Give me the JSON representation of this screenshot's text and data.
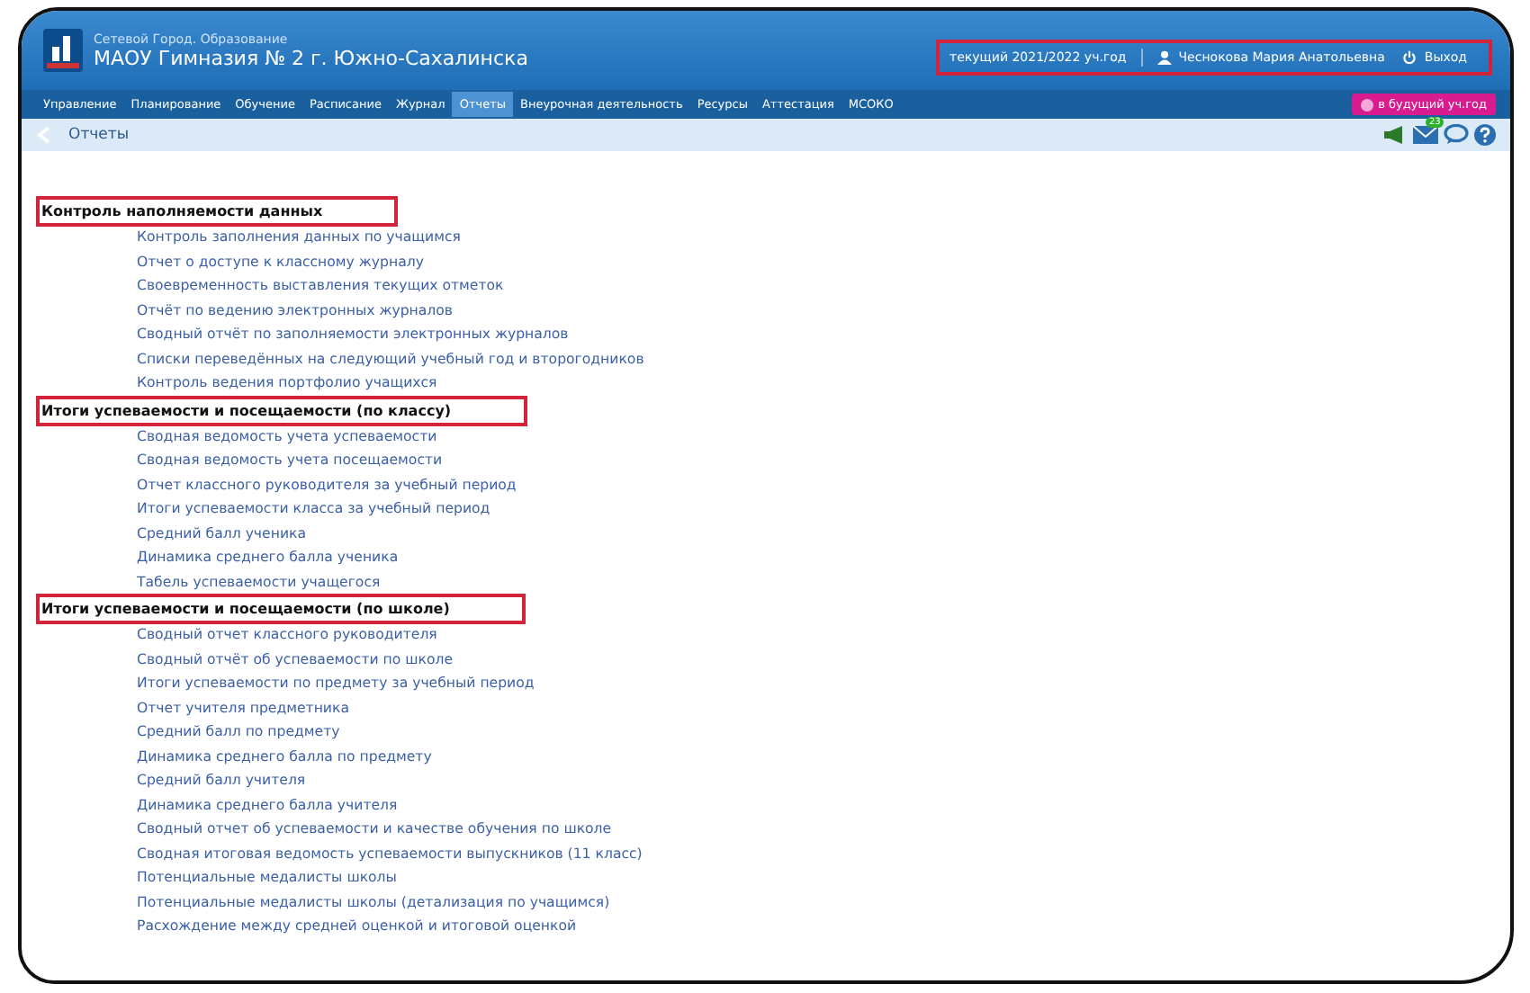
{
  "header": {
    "system": "Сетевой Город. Образование",
    "school": "МАОУ Гимназия № 2 г. Южно-Сахалинска",
    "year": "текущий 2021/2022 уч.год",
    "user": "Чеснокова Мария Анатольевна",
    "logout": "Выход",
    "highlighted": true
  },
  "nav": [
    {
      "label": "Управление",
      "selected": false
    },
    {
      "label": "Планирование",
      "selected": false
    },
    {
      "label": "Обучение",
      "selected": false
    },
    {
      "label": "Расписание",
      "selected": false
    },
    {
      "label": "Журнал",
      "selected": false
    },
    {
      "label": "Отчеты",
      "selected": true
    },
    {
      "label": "Внеурочная деятельность",
      "selected": false
    },
    {
      "label": "Ресурсы",
      "selected": false
    },
    {
      "label": "Аттестация",
      "selected": false
    },
    {
      "label": "МСОКО",
      "selected": false
    }
  ],
  "future_year_button": "в будущий уч.год",
  "breadcrumb": "Отчеты",
  "mail_badge": "23",
  "sections": [
    {
      "title": "Контроль наполняемости данных",
      "highlighted": true,
      "items": [
        "Контроль заполнения данных по учащимся",
        "Отчет о доступе к классному журналу",
        "Своевременность выставления текущих отметок",
        "Отчёт по ведению электронных журналов",
        "Сводный отчёт по заполняемости электронных журналов",
        "Списки переведённых на следующий учебный год и второгодников",
        "Контроль ведения портфолио учащихся"
      ]
    },
    {
      "title": "Итоги успеваемости и посещаемости (по классу)",
      "highlighted": true,
      "items": [
        "Сводная ведомость учета успеваемости",
        "Сводная ведомость учета посещаемости",
        "Отчет классного руководителя за учебный период",
        "Итоги успеваемости класса за учебный период",
        "Средний балл ученика",
        "Динамика среднего балла ученика",
        "Табель успеваемости учащегося"
      ]
    },
    {
      "title": "Итоги успеваемости и посещаемости (по школе)",
      "highlighted": true,
      "items": [
        "Сводный отчет классного руководителя",
        "Сводный отчёт об успеваемости по школе",
        "Итоги успеваемости по предмету за учебный период",
        "Отчет учителя предметника",
        "Средний балл по предмету",
        "Динамика среднего балла по предмету",
        "Средний балл учителя",
        "Динамика среднего балла учителя",
        "Сводный отчет об успеваемости и качестве обучения по школе",
        "Сводная итоговая ведомость успеваемости выпускников (11 класс)",
        "Потенциальные медалисты школы",
        "Потенциальные медалисты школы (детализация по учащимся)",
        "Расхождение между средней оценкой и итоговой оценкой"
      ]
    }
  ]
}
